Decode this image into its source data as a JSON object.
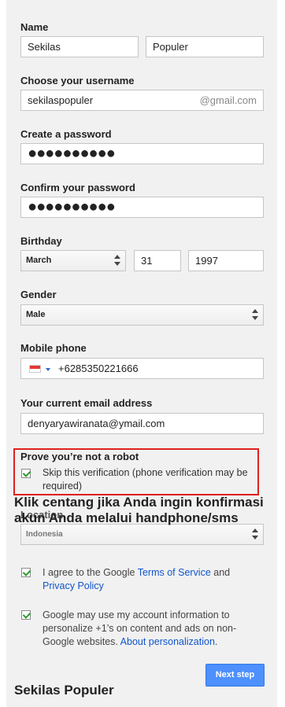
{
  "name": {
    "label": "Name",
    "first": "Sekilas",
    "last": "Populer"
  },
  "username": {
    "label": "Choose your username",
    "value": "sekilaspopuler",
    "suffix": "@gmail.com"
  },
  "password": {
    "label": "Create a password",
    "value": "●●●●●●●●●●"
  },
  "confirm": {
    "label": "Confirm your password",
    "value": "●●●●●●●●●●"
  },
  "birthday": {
    "label": "Birthday",
    "month": "March",
    "day": "31",
    "year": "1997"
  },
  "gender": {
    "label": "Gender",
    "value": "Male"
  },
  "mobile": {
    "label": "Mobile phone",
    "value": "+6285350221666"
  },
  "email": {
    "label": "Your current email address",
    "value": "denyaryawiranata@ymail.com"
  },
  "robot": {
    "title": "Prove you’re not a robot",
    "skip": "Skip this verification (phone verification may be required)"
  },
  "annotation": "Klik centang jika Anda ingin konfirmasi akun Anda melalui handphone/sms",
  "location": {
    "label": "Location",
    "value": "Indonesia"
  },
  "terms": {
    "prefix": "I agree to the Google ",
    "tos": "Terms of Service",
    "and": " and",
    "privacy": "Privacy Policy"
  },
  "personalize": {
    "text": "Google may use my account information to personalize +1’s on content and ads on non-Google websites. ",
    "link": "About personalization",
    "end": "."
  },
  "next_button": "Next step",
  "watermark": "Sekilas Populer",
  "colors": {
    "accent": "#4d90fe",
    "highlight": "#e02020",
    "check": "#2c9a2c",
    "link": "#1155cc"
  }
}
